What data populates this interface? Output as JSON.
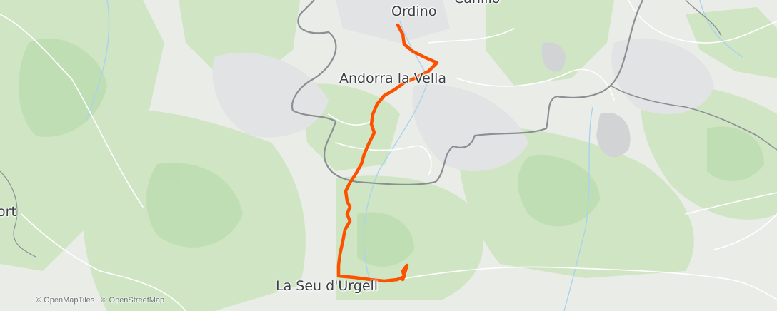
{
  "map": {
    "places": [
      {
        "id": "ordino",
        "name": "Ordino"
      },
      {
        "id": "canillo",
        "name": "Canillo"
      },
      {
        "id": "andorra",
        "name": "Andorra la Vella"
      },
      {
        "id": "seu",
        "name": "La Seu d'Urgell"
      },
      {
        "id": "sort",
        "name": "Sort"
      }
    ],
    "attribution": [
      "© OpenMapTiles",
      "© OpenStreetMap"
    ],
    "colors": {
      "land": "#e9ece7",
      "forest": "#cfe5c4",
      "forest_dark": "#bcdcaf",
      "bare_rock": "#e1e3e4",
      "route": "#fc5200",
      "border": "#7f8488",
      "road": "#ffffff",
      "water": "#a9d3ef"
    }
  }
}
